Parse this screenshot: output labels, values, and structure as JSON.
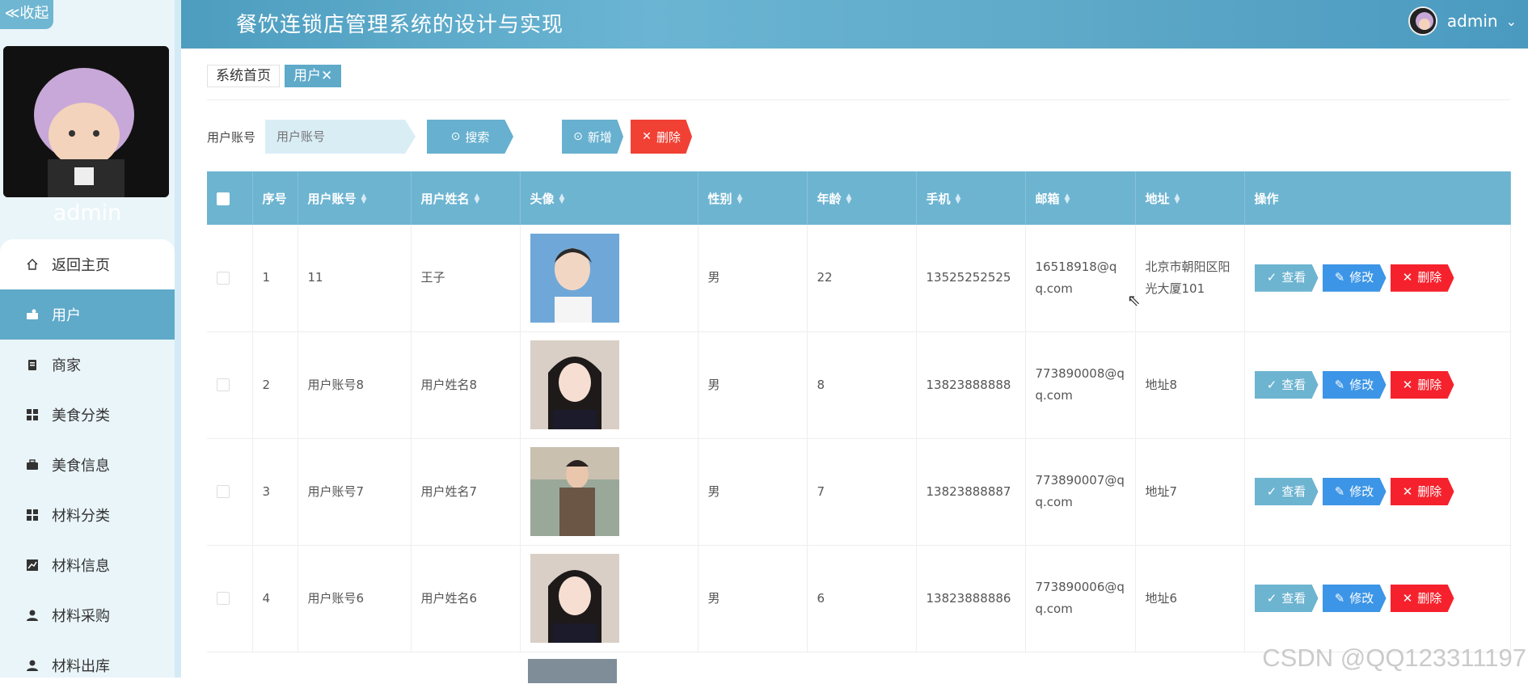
{
  "app": {
    "title": "餐饮连锁店管理系统的设计与实现",
    "collapse_label": "≪收起"
  },
  "user": {
    "name": "admin",
    "dropdown_icon": "chevron-down-icon"
  },
  "sidebar": {
    "name": "admin",
    "items": [
      {
        "label": "返回主页",
        "icon": "home-icon"
      },
      {
        "label": "用户",
        "icon": "user-card-icon"
      },
      {
        "label": "商家",
        "icon": "clipboard-icon"
      },
      {
        "label": "美食分类",
        "icon": "grid-icon"
      },
      {
        "label": "美食信息",
        "icon": "briefcase-icon"
      },
      {
        "label": "材料分类",
        "icon": "grid-icon"
      },
      {
        "label": "材料信息",
        "icon": "chart-icon"
      },
      {
        "label": "材料采购",
        "icon": "person-icon"
      },
      {
        "label": "材料出库",
        "icon": "person-icon"
      }
    ]
  },
  "tabs": [
    {
      "label": "系统首页"
    },
    {
      "label": "用户✕"
    }
  ],
  "search": {
    "label": "用户账号",
    "placeholder": "用户账号",
    "search_btn": "搜索",
    "add_btn": "新增",
    "delete_btn": "删除"
  },
  "table": {
    "headers": [
      "序号",
      "用户账号",
      "用户姓名",
      "头像",
      "性别",
      "年龄",
      "手机",
      "邮箱",
      "地址",
      "操作"
    ],
    "rows": [
      {
        "idx": "1",
        "account": "11",
        "name": "王子",
        "gender": "男",
        "age": "22",
        "phone": "13525252525",
        "email": "16518918@qq.com",
        "address": "北京市朝阳区阳光大厦101"
      },
      {
        "idx": "2",
        "account": "用户账号8",
        "name": "用户姓名8",
        "gender": "男",
        "age": "8",
        "phone": "13823888888",
        "email": "773890008@qq.com",
        "address": "地址8"
      },
      {
        "idx": "3",
        "account": "用户账号7",
        "name": "用户姓名7",
        "gender": "男",
        "age": "7",
        "phone": "13823888887",
        "email": "773890007@qq.com",
        "address": "地址7"
      },
      {
        "idx": "4",
        "account": "用户账号6",
        "name": "用户姓名6",
        "gender": "男",
        "age": "6",
        "phone": "13823888886",
        "email": "773890006@qq.com",
        "address": "地址6"
      }
    ],
    "ops": {
      "view": "查看",
      "edit": "修改",
      "delete": "删除"
    }
  },
  "watermark": "CSDN @QQ123311197",
  "colors": {
    "primary": "#5fa9c9",
    "danger": "#f04134",
    "edit": "#3c95e6"
  }
}
